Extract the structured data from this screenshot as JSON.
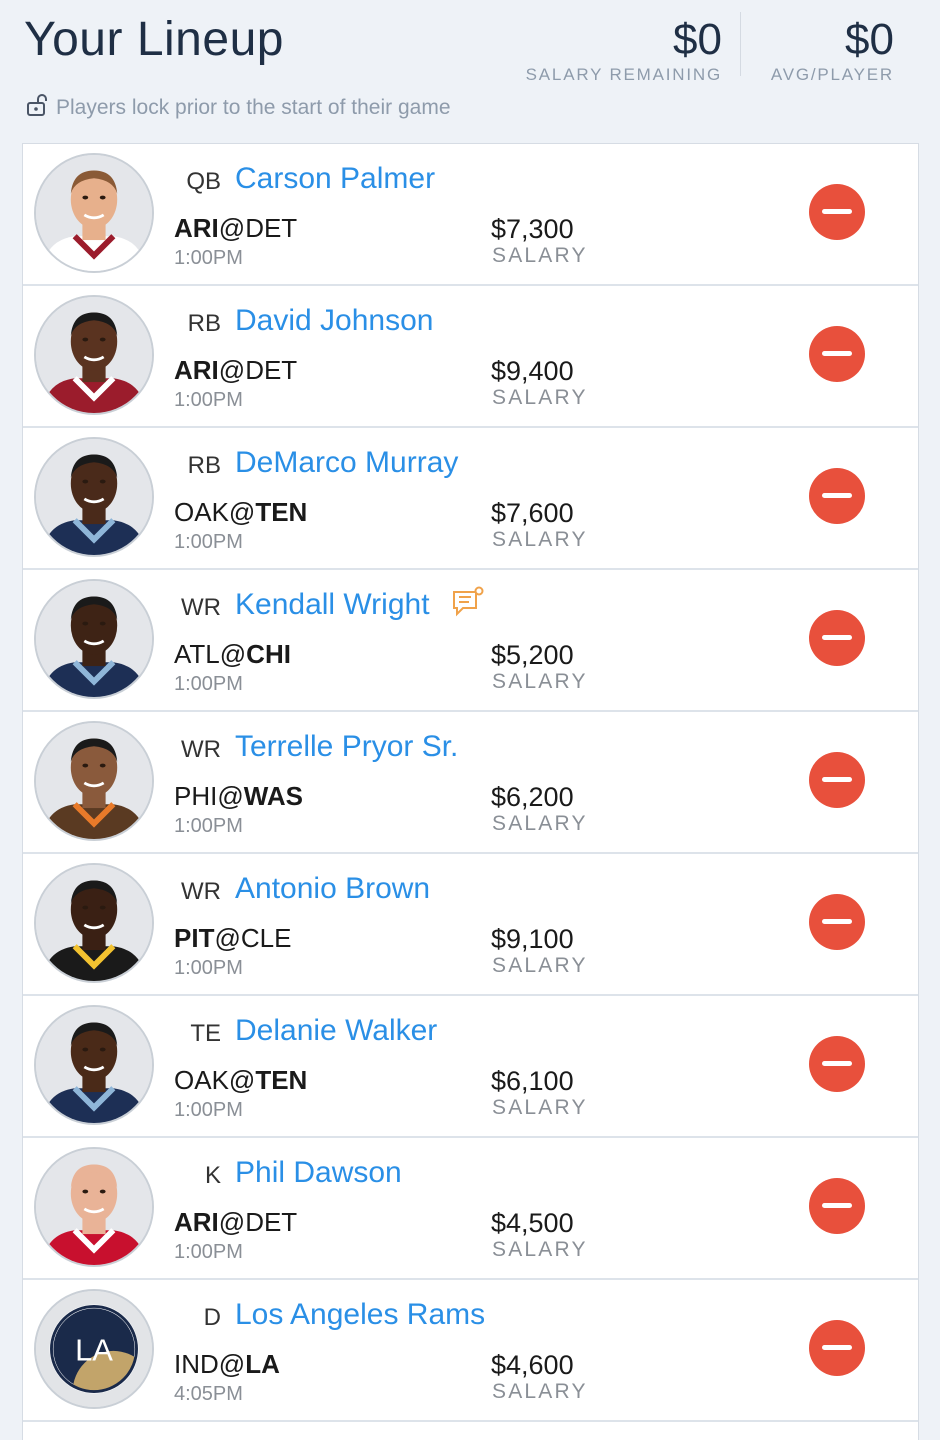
{
  "header": {
    "title": "Your Lineup",
    "salary_remaining_value": "$0",
    "salary_remaining_label": "SALARY REMAINING",
    "avg_value": "$0",
    "avg_label": "AVG/PLAYER",
    "lock_notice": "Players lock prior to the start of their game"
  },
  "salary_label": "SALARY",
  "players": [
    {
      "pos": "QB",
      "name": "Carson Palmer",
      "away": "ARI",
      "home": "DET",
      "bold": "away",
      "time": "1:00PM",
      "salary": "$7,300",
      "jersey": "#ffffff",
      "trim": "#9b1c2c",
      "skin": "#e7b08c",
      "hair": "#8a5a36"
    },
    {
      "pos": "RB",
      "name": "David Johnson",
      "away": "ARI",
      "home": "DET",
      "bold": "away",
      "time": "1:00PM",
      "salary": "$9,400",
      "jersey": "#9b1c2c",
      "trim": "#ffffff",
      "skin": "#5a3320",
      "hair": "#1a1a1a"
    },
    {
      "pos": "RB",
      "name": "DeMarco Murray",
      "away": "OAK",
      "home": "TEN",
      "bold": "home",
      "time": "1:00PM",
      "salary": "$7,600",
      "jersey": "#1d2f55",
      "trim": "#8fb6d8",
      "skin": "#4a2a1a",
      "hair": "#1a1a1a"
    },
    {
      "pos": "WR",
      "name": "Kendall Wright",
      "away": "ATL",
      "home": "CHI",
      "bold": "home",
      "time": "1:00PM",
      "salary": "$5,200",
      "jersey": "#1d2f55",
      "trim": "#8fb6d8",
      "skin": "#3e2315",
      "hair": "#1a1a1a",
      "note": true
    },
    {
      "pos": "WR",
      "name": "Terrelle Pryor Sr.",
      "away": "PHI",
      "home": "WAS",
      "bold": "home",
      "time": "1:00PM",
      "salary": "$6,200",
      "jersey": "#5a3a22",
      "trim": "#e87a2a",
      "skin": "#8a5a3c",
      "hair": "#1a1a1a"
    },
    {
      "pos": "WR",
      "name": "Antonio Brown",
      "away": "PIT",
      "home": "CLE",
      "bold": "away",
      "time": "1:00PM",
      "salary": "$9,100",
      "jersey": "#1a1a1a",
      "trim": "#f2c230",
      "skin": "#3a2014",
      "hair": "#1a1a1a"
    },
    {
      "pos": "TE",
      "name": "Delanie Walker",
      "away": "OAK",
      "home": "TEN",
      "bold": "home",
      "time": "1:00PM",
      "salary": "$6,100",
      "jersey": "#1d2f55",
      "trim": "#8fb6d8",
      "skin": "#4a2a18",
      "hair": "#1a1a1a"
    },
    {
      "pos": "K",
      "name": "Phil Dawson",
      "away": "ARI",
      "home": "DET",
      "bold": "away",
      "time": "1:00PM",
      "salary": "$4,500",
      "jersey": "#c8102e",
      "trim": "#ffffff",
      "skin": "#e9b397",
      "hair": "#e9b397"
    },
    {
      "pos": "D",
      "name": "Los Angeles Rams",
      "away": "IND",
      "home": "LA",
      "bold": "home",
      "time": "4:05PM",
      "salary": "$4,600",
      "logo": "LA"
    }
  ]
}
